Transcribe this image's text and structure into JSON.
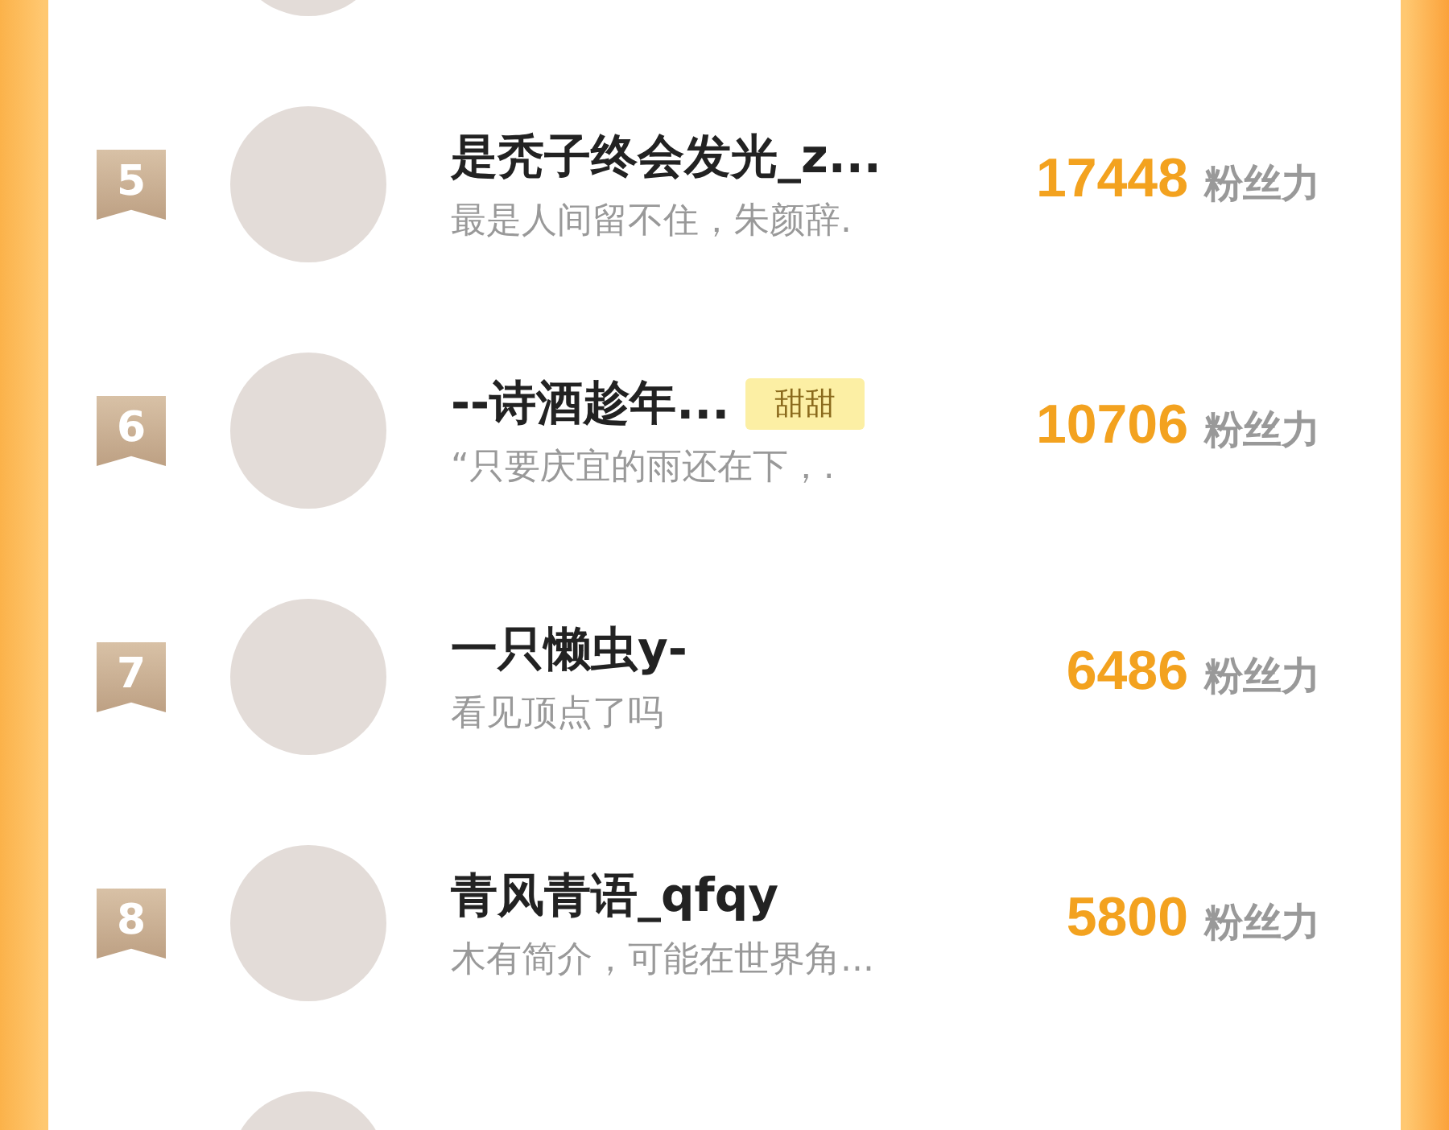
{
  "rows": [
    {
      "rank": "5",
      "name": "是秃子终会发光_z...",
      "tag": null,
      "bio": "最是人间留不住，朱颜辞.",
      "score": "17448",
      "unit": "粉丝力"
    },
    {
      "rank": "6",
      "name": "--诗酒趁年...",
      "tag": "甜甜",
      "bio": "“只要庆宜的雨还在下，.",
      "score": "10706",
      "unit": "粉丝力"
    },
    {
      "rank": "7",
      "name": "一只懒虫y-",
      "tag": null,
      "bio": "看见顶点了吗",
      "score": "6486",
      "unit": "粉丝力"
    },
    {
      "rank": "8",
      "name": "青风青语_qfqy",
      "tag": null,
      "bio": "木有简介，可能在世界角...",
      "score": "5800",
      "unit": "粉丝力"
    }
  ]
}
